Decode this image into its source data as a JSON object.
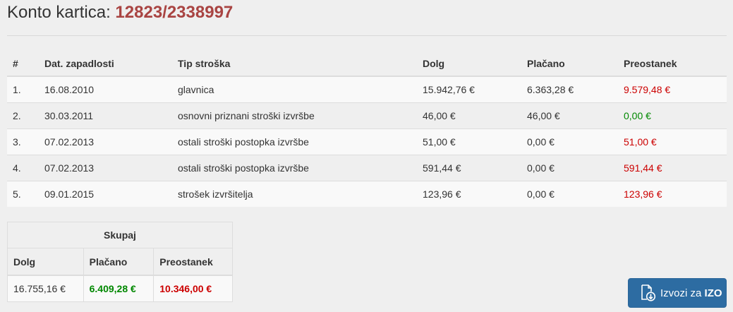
{
  "header": {
    "title_prefix": "Konto kartica:",
    "account_number": "12823/2338997"
  },
  "table": {
    "headers": {
      "num": "#",
      "due_date": "Dat. zapadlosti",
      "cost_type": "Tip stroška",
      "debt": "Dolg",
      "paid": "Plačano",
      "remaining": "Preostanek"
    },
    "rows": [
      {
        "num": "1.",
        "due_date": "16.08.2010",
        "cost_type": "glavnica",
        "debt": "15.942,76 €",
        "paid": "6.363,28 €",
        "remaining": "9.579,48 €"
      },
      {
        "num": "2.",
        "due_date": "30.03.2011",
        "cost_type": "osnovni priznani stroški izvršbe",
        "debt": "46,00 €",
        "paid": "46,00 €",
        "remaining": "0,00 €"
      },
      {
        "num": "3.",
        "due_date": "07.02.2013",
        "cost_type": "ostali stroški postopka izvršbe",
        "debt": "51,00 €",
        "paid": "0,00 €",
        "remaining": "51,00 €"
      },
      {
        "num": "4.",
        "due_date": "07.02.2013",
        "cost_type": "ostali stroški postopka izvršbe",
        "debt": "591,44 €",
        "paid": "0,00 €",
        "remaining": "591,44 €"
      },
      {
        "num": "5.",
        "due_date": "09.01.2015",
        "cost_type": "strošek izvršitelja",
        "debt": "123,96 €",
        "paid": "0,00 €",
        "remaining": "123,96 €"
      }
    ]
  },
  "summary": {
    "caption": "Skupaj",
    "headers": {
      "debt": "Dolg",
      "paid": "Plačano",
      "remaining": "Preostanek"
    },
    "values": {
      "debt": "16.755,16 €",
      "paid": "6.409,28 €",
      "remaining": "10.346,00 €"
    }
  },
  "export_button": {
    "label_prefix": "Izvozi za",
    "label_bold": "IZO",
    "icon": "file-download-icon"
  },
  "colors": {
    "accent_red": "#a94442",
    "negative": "#cc0000",
    "positive": "#008800",
    "button_blue": "#2d6ca2"
  }
}
